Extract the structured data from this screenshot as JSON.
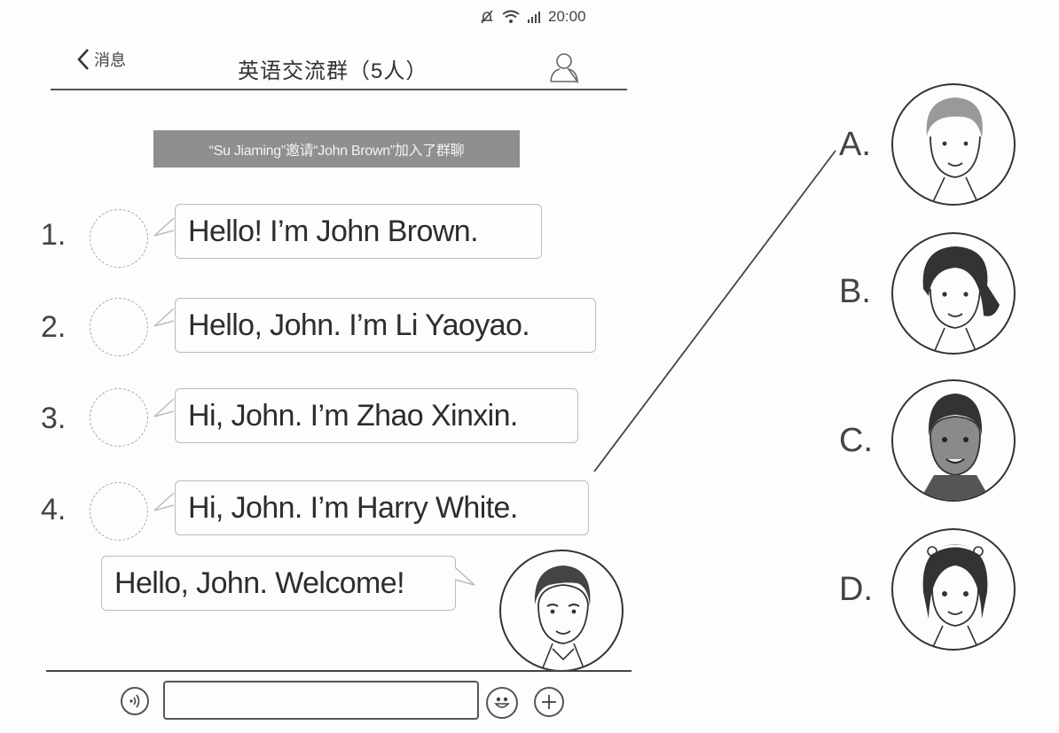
{
  "status_bar": {
    "time": "20:00",
    "icons": [
      "mute-bell-icon",
      "wifi-icon",
      "signal-icon"
    ]
  },
  "header": {
    "back_label": "消息",
    "title": "英语交流群（5人）",
    "profile_icon": "person-icon"
  },
  "notice": "“Su Jiaming”邀请“John Brown”加入了群聊",
  "messages": [
    {
      "number": "1.",
      "text": "Hello! I’m John Brown."
    },
    {
      "number": "2.",
      "text": "Hello, John. I’m Li Yaoyao."
    },
    {
      "number": "3.",
      "text": "Hi, John. I’m Zhao Xinxin."
    },
    {
      "number": "4.",
      "text": "Hi, John. I’m Harry White."
    }
  ],
  "own_message": {
    "text": "Hello, John. Welcome!"
  },
  "options": [
    {
      "letter": "A."
    },
    {
      "letter": "B."
    },
    {
      "letter": "C."
    },
    {
      "letter": "D."
    }
  ],
  "footer": {
    "voice_icon": "voice-icon",
    "emoji_icon": "emoji-icon",
    "plus_icon": "plus-icon",
    "input_value": ""
  }
}
